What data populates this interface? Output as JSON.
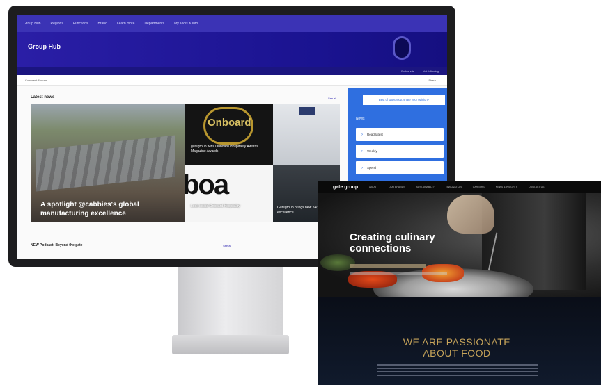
{
  "monitor": {
    "topnav": [
      "Group Hub",
      "Regions",
      "Functions",
      "Brand",
      "Learn more",
      "Departments",
      "My Tools & Info"
    ],
    "site_title": "Group Hub",
    "subbar": [
      "Follow site",
      "Not following"
    ],
    "cmdbar_left": "Comment & share",
    "cmdbar_right": "Share",
    "news_heading": "Latest news",
    "see_all": "See all",
    "tiles": [
      {
        "caption": "A spotlight @cabbies's global manufacturing excellence"
      },
      {
        "logo": "Onboard",
        "caption": "gategroup wins Onboard Hospitality Awards Magazine Awards"
      },
      {
        "caption": ""
      },
      {
        "big_text": "boa",
        "caption": "Look inside Onboard Hospitality"
      },
      {
        "caption": "Gategroup brings new 24/7 culinary excellence"
      }
    ],
    "podcast_title": "NEW Podcast: Beyond the gate",
    "podcast_see_all": "See all",
    "panel": {
      "ask_button": "Best of gategroup, share your opinion?",
      "news_heading": "News",
      "items": [
        "Read latest",
        "Weekly",
        "Spend"
      ]
    }
  },
  "laptop": {
    "brand": "gate group",
    "nav": [
      "ABOUT",
      "OUR BRANDS",
      "SUSTAINABILITY",
      "INNOVATION",
      "CAREERS",
      "NEWS & INSIGHTS",
      "CONTACT US"
    ],
    "hero_title": "Creating culinary connections",
    "passion_heading": "WE ARE PASSIONATE ABOUT FOOD"
  }
}
